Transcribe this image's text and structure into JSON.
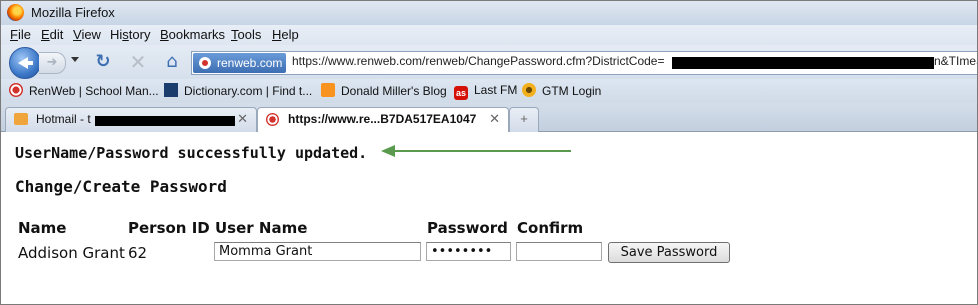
{
  "window": {
    "title": "Mozilla Firefox"
  },
  "menubar": {
    "items": [
      {
        "key": "F",
        "rest": "ile"
      },
      {
        "key": "E",
        "rest": "dit"
      },
      {
        "key": "V",
        "rest": "iew"
      },
      {
        "key": "",
        "rest": "Hi",
        "key2": "s",
        "rest2": "tory"
      },
      {
        "key": "B",
        "rest": "ookmarks"
      },
      {
        "key": "T",
        "rest": "ools"
      },
      {
        "key": "H",
        "rest": "elp"
      }
    ]
  },
  "navbar": {
    "site_identity": "renweb.com",
    "url": "https://www.renweb.com/renweb/ChangePassword.cfm?DistrictCode=",
    "url_tail": "n&TImeSt"
  },
  "bookmarks": [
    {
      "label": "RenWeb | School Man...",
      "icon": "renweb-icon"
    },
    {
      "label": "Dictionary.com | Find t...",
      "icon": "dictionary-icon"
    },
    {
      "label": "Donald Miller's Blog",
      "icon": "rss-icon"
    },
    {
      "label": "Last FM",
      "icon": "lastfm-icon"
    },
    {
      "label": "GTM Login",
      "icon": "gtm-icon"
    }
  ],
  "tabs": [
    {
      "label": "Hotmail - t",
      "icon": "mail-icon",
      "active": false
    },
    {
      "label": "https://www.re...B7DA517EA1047",
      "icon": "renweb-icon",
      "active": true
    }
  ],
  "new_tab_symbol": "+",
  "content": {
    "success_message": "UserName/Password successfully updated.",
    "heading": "Change/Create Password",
    "columns": [
      "Name",
      "Person ID",
      "User Name",
      "Password",
      "Confirm"
    ],
    "row": {
      "name": "Addison Grant",
      "person_id": "62",
      "user_name": "Momma Grant",
      "password": "password",
      "confirm": ""
    },
    "save_label": "Save Password"
  },
  "colors": {
    "arrow": "#5a9a4e",
    "accent": "#3d6eb3"
  }
}
